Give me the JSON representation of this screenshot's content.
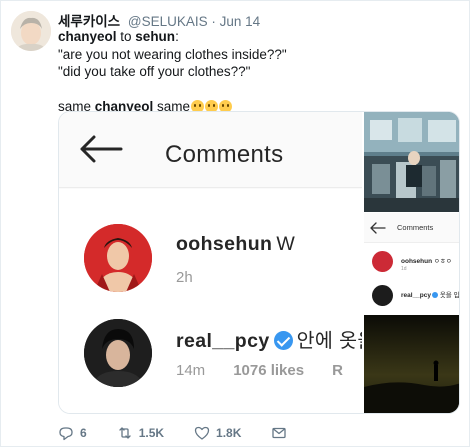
{
  "tweet": {
    "display_name": "세루카이스",
    "handle": "@SELUKAIS",
    "separator": "·",
    "date": "Jun 14",
    "line1_bold_1": "chanyeol",
    "line1_mid": " to ",
    "line1_bold_2": "sehun",
    "line1_end": ":",
    "line2": "\"are you not wearing clothes inside??\"",
    "line3": "\"did you take off your clothes??\"",
    "line5_start": "same ",
    "line5_bold": "chanyeol",
    "line5_end": " same",
    "emoji_name": "hushed-face-emoji"
  },
  "media": {
    "screenshot_title": "Comments",
    "comments": [
      {
        "user": "oohsehun",
        "text": "W",
        "age": "2h"
      },
      {
        "user": "real__pcy",
        "text": "안에 옷을",
        "age": "14m",
        "likes": "1076 likes",
        "reply": "R"
      }
    ],
    "mini": {
      "title": "Comments",
      "comments": [
        {
          "user": "oohsehun",
          "text": "ㅇㅎㅇ",
          "age": "1d"
        },
        {
          "user": "real__pcy",
          "text": "옷을 입"
        }
      ]
    }
  },
  "actions": {
    "replies": "6",
    "retweets": "1.5K",
    "likes": "1.8K"
  },
  "colors": {
    "secondary_text": "#657786",
    "verified_blue": "#3897f0",
    "emoji_yellow": "#ffcc4d"
  }
}
